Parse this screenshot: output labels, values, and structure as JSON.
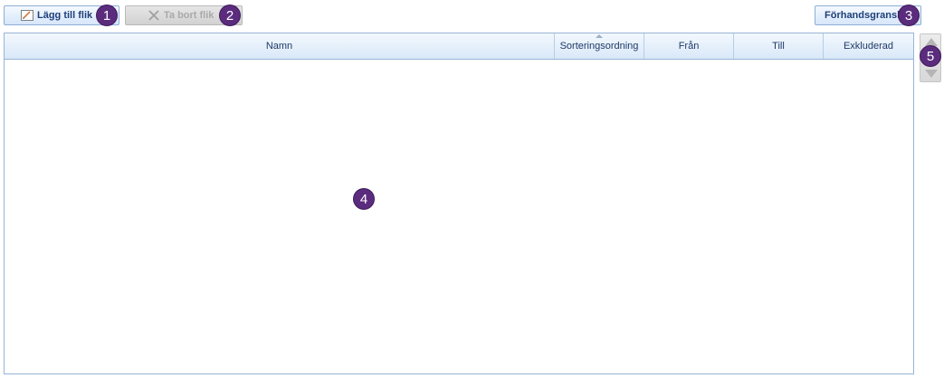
{
  "toolbar": {
    "add_tab_label": "Lägg till flik",
    "remove_tab_label": "Ta bort flik",
    "preview_label": "Förhandsgransk"
  },
  "badges": [
    "1",
    "2",
    "3",
    "4",
    "5"
  ],
  "grid": {
    "columns": [
      "Namn",
      "Sorteringsordning",
      "Från",
      "Till",
      "Exkluderad"
    ],
    "sorted_column": "Sorteringsordning",
    "rows": []
  },
  "colors": {
    "badge": "#5b2c7e",
    "header_border": "#99b4d6"
  }
}
